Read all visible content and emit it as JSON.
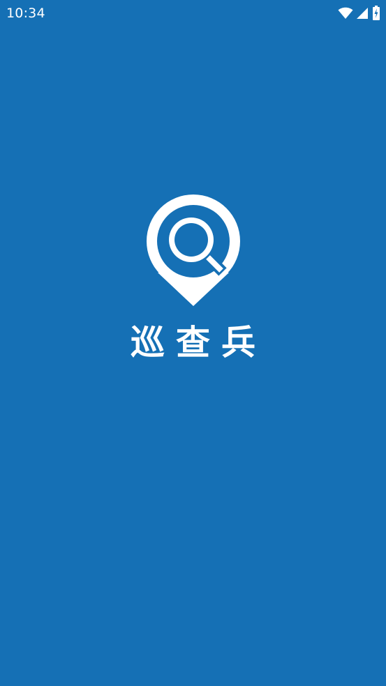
{
  "status_bar": {
    "time": "10:34",
    "icons": [
      "wifi-icon",
      "cellular-signal-icon",
      "battery-charging-icon"
    ]
  },
  "splash": {
    "logo_icon": "location-pin-search-icon",
    "app_name": "巡查兵"
  },
  "colors": {
    "background": "#1570b5",
    "foreground": "#ffffff"
  }
}
